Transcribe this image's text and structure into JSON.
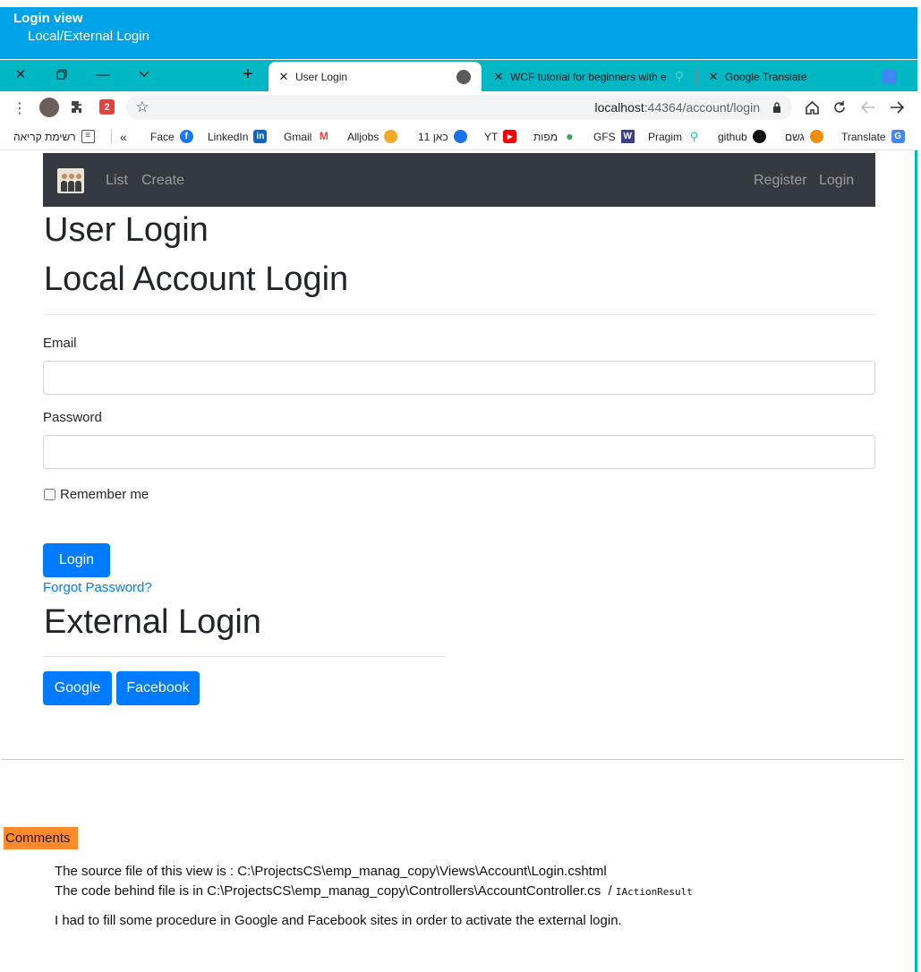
{
  "caption": {
    "title": "Login view",
    "subtitle": "Local/External Login"
  },
  "browser": {
    "tabs": [
      {
        "label": "User Login",
        "active": true
      },
      {
        "label": "WCF tutorial for beginners with e",
        "active": false
      },
      {
        "label": "Google Translate",
        "active": false
      }
    ],
    "url_host": "localhost",
    "url_path": ":44364/account/login",
    "bookmarks": [
      {
        "label": "רשימת קריאה",
        "icon": "reading-list-icon"
      },
      {
        "label": "Face",
        "icon": "facebook-icon",
        "color": "#1877f2"
      },
      {
        "label": "LinkedIn",
        "icon": "linkedin-icon",
        "color": "#0a66c2"
      },
      {
        "label": "Gmail",
        "icon": "gmail-icon",
        "color": "#ea4335"
      },
      {
        "label": "Alljobs",
        "icon": "alljobs-icon",
        "color": "#f5a623"
      },
      {
        "label": "כאן 11",
        "icon": "kan11-icon",
        "color": "#1a73e8"
      },
      {
        "label": "YT",
        "icon": "youtube-icon",
        "color": "#ff0000"
      },
      {
        "label": "מפות",
        "icon": "maps-icon",
        "color": "#34a853"
      },
      {
        "label": "GFS",
        "icon": "gfs-icon",
        "color": "#3b3f8f"
      },
      {
        "label": "Pragim",
        "icon": "pragim-icon",
        "color": "#22b8c8"
      },
      {
        "label": "github",
        "icon": "github-icon",
        "color": "#111111"
      },
      {
        "label": "גשם",
        "icon": "rain-icon",
        "color": "#f28c00"
      },
      {
        "label": "Translate",
        "icon": "translate-icon",
        "color": "#4285f4"
      }
    ]
  },
  "navbar": {
    "left_links": [
      "List",
      "Create"
    ],
    "right_links": [
      "Register",
      "Login"
    ]
  },
  "page": {
    "title": "User Login",
    "local_heading": "Local Account Login",
    "email_label": "Email",
    "email_value": "",
    "password_label": "Password",
    "password_value": "",
    "remember_label": "Remember me",
    "remember_checked": false,
    "login_button": "Login",
    "forgot_link": "Forgot Password?",
    "external_heading": "External Login",
    "external_buttons": [
      "Google",
      "Facebook"
    ]
  },
  "comments": {
    "tag": "Comments",
    "line1": "The source file of this view is : C:\\ProjectsCS\\emp_manag_copy\\Views\\Account\\Login.cshtml",
    "line2_prefix": "The code behind file is in  C:\\ProjectsCS\\emp_manag_copy\\Controllers\\AccountController.cs",
    "line2_sep": "/",
    "line2_code": "IActionResult",
    "line3": "I had to fill some procedure in Google and Facebook sites in order to activate the external login."
  },
  "colors": {
    "caption_bg": "#00a2e8",
    "tabstrip_bg": "#00b7c3",
    "navbar_bg": "#343a40",
    "primary": "#007bff",
    "comments_tag_bg": "#ff8a2b"
  }
}
